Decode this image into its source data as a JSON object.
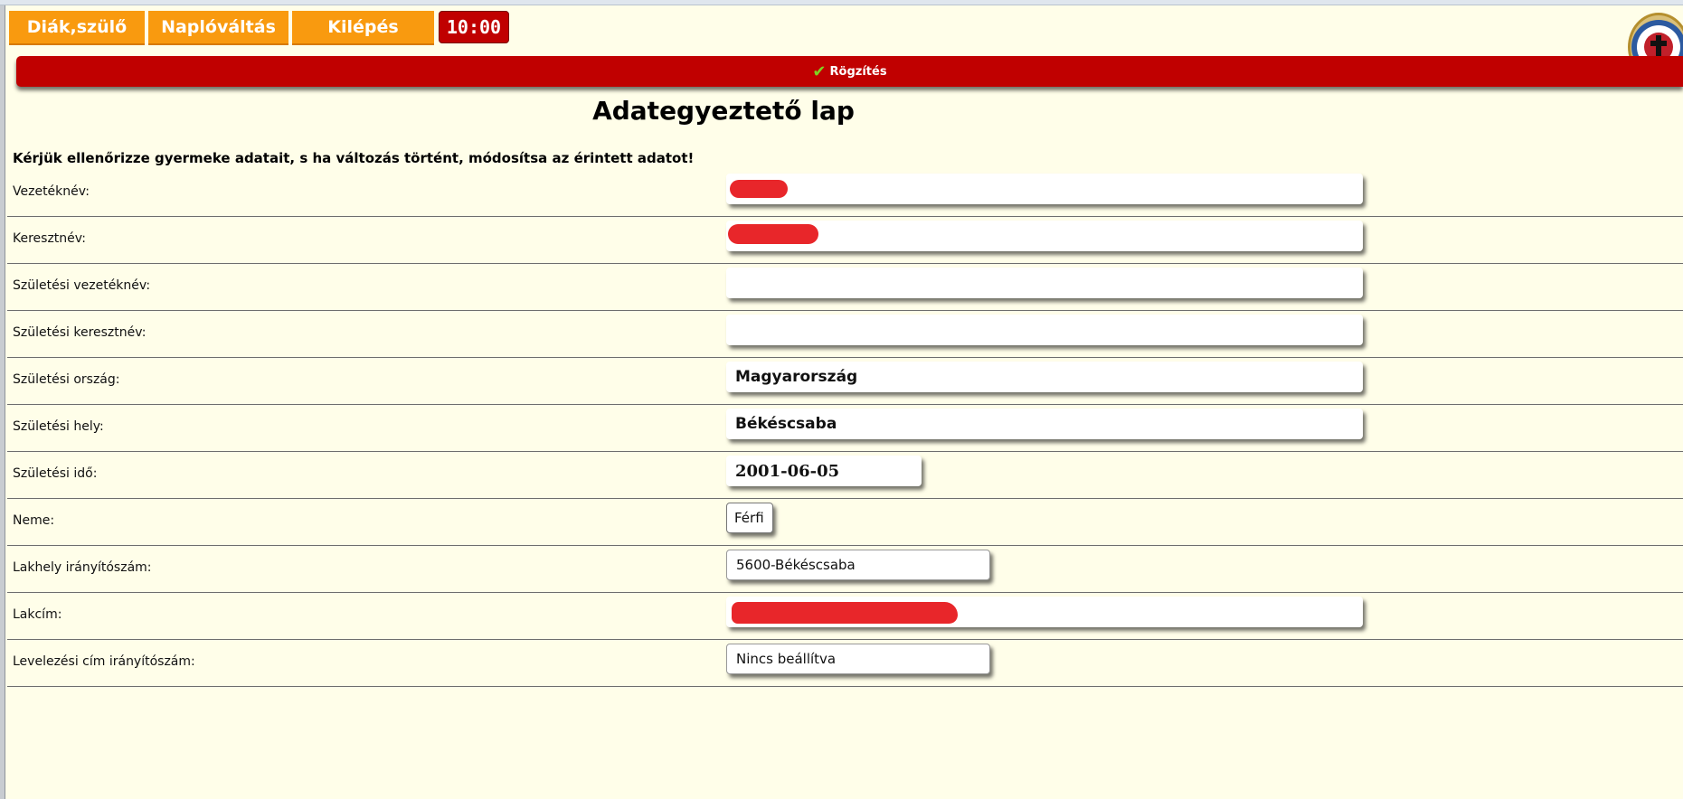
{
  "nav": {
    "student_parent": "Diák,szülő",
    "switch_log": "Naplóváltás",
    "logout": "Kilépés",
    "timer": "10:00"
  },
  "save_bar": {
    "label": "Rögzítés",
    "icon": "check-icon",
    "check_color": "#7ed321"
  },
  "colors": {
    "accent_orange": "#f99a0f",
    "accent_red": "#c00000",
    "background": "#fffee9"
  },
  "title": "Adategyeztető lap",
  "notice": "Kérjük ellenőrizze gyermeke adatait, s ha változás történt, módosítsa az érintett adatot!",
  "fields": [
    {
      "label": "Vezetéknév:",
      "value": ""
    },
    {
      "label": "Keresztnév:",
      "value": ""
    },
    {
      "label": "Születési vezetéknév:",
      "value": ""
    },
    {
      "label": "Születési keresztnév:",
      "value": ""
    },
    {
      "label": "Születési ország:",
      "value": "Magyarország"
    },
    {
      "label": "Születési hely:",
      "value": "Békéscsaba"
    },
    {
      "label": "Születési idő:",
      "value": "2001-06-05"
    },
    {
      "label": "Neme:",
      "value": "Férfi"
    },
    {
      "label": "Lakhely irányítószám:",
      "value": "5600-Békéscsaba"
    },
    {
      "label": "Lakcím:",
      "value": ""
    },
    {
      "label": "Levelezési cím irányítószám:",
      "value": "Nincs beállítva"
    }
  ]
}
